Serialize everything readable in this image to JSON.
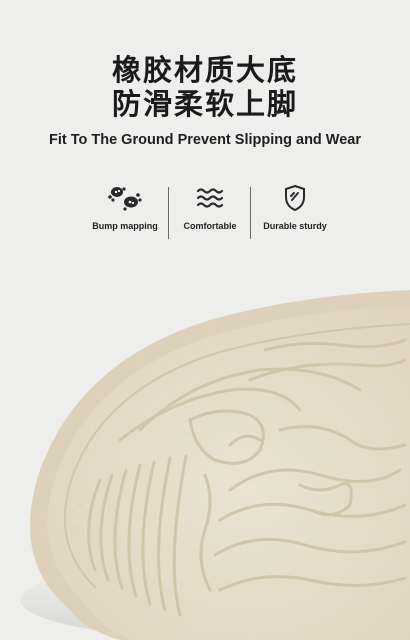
{
  "heading": {
    "line1": "橡胶材质大底",
    "line2": "防滑柔软上脚",
    "subtitle": "Fit To The Ground Prevent Slipping and Wear"
  },
  "features": [
    {
      "label": "Bump mapping",
      "icon": "footprint-icon"
    },
    {
      "label": "Comfortable",
      "icon": "wavy-lines-icon"
    },
    {
      "label": "Durable sturdy",
      "icon": "shield-icon"
    }
  ],
  "colors": {
    "background": "#eeeeec",
    "sole": "#e7ddcc",
    "sole_tread": "#d8ccb6",
    "text": "#1b1b1b"
  }
}
